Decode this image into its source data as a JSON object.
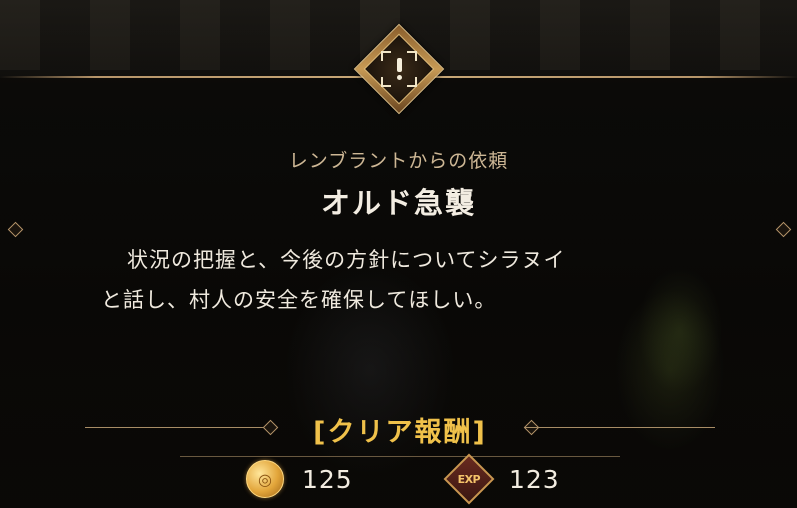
{
  "quest": {
    "requester": "レンブラントからの依頼",
    "title": "オルド急襲",
    "description_line1": "状況の把握と、今後の方針についてシラヌイ",
    "description_line2": "と話し、村人の安全を確保してほしい。",
    "emblem_icon": "alert-exclamation-icon"
  },
  "rewards": {
    "title": "[クリア報酬]",
    "gold": {
      "icon": "gold-coin-icon",
      "value": "125"
    },
    "exp": {
      "icon": "exp-badge-icon",
      "label": "EXP",
      "value": "123"
    }
  },
  "colors": {
    "accent_gold": "#f0c14a",
    "ornament": "#b6956a",
    "requester_text": "#cdb795"
  }
}
